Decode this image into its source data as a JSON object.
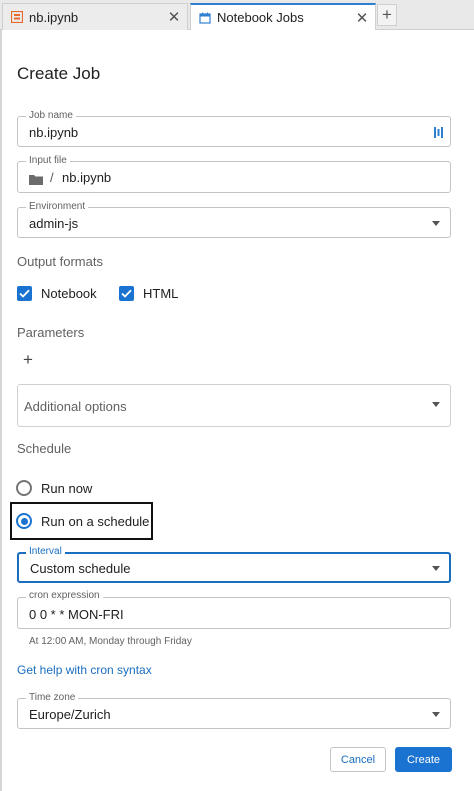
{
  "tabs": [
    {
      "label": "nb.ipynb",
      "icon": "notebook-icon",
      "active": false
    },
    {
      "label": "Notebook Jobs",
      "icon": "calendar-icon",
      "active": true
    }
  ],
  "tab_close_glyph": "✕",
  "tab_add_glyph": "+",
  "page_title": "Create Job",
  "job_name": {
    "label": "Job name",
    "value": "nb.ipynb"
  },
  "input_file": {
    "label": "Input file",
    "separator": "/",
    "value": "nb.ipynb"
  },
  "environment": {
    "label": "Environment",
    "value": "admin-js"
  },
  "output_formats": {
    "label": "Output formats",
    "options": [
      {
        "label": "Notebook",
        "checked": true
      },
      {
        "label": "HTML",
        "checked": true
      }
    ]
  },
  "parameters": {
    "label": "Parameters",
    "add_glyph": "+"
  },
  "additional_options": {
    "label": "Additional options"
  },
  "schedule": {
    "label": "Schedule",
    "options": [
      {
        "label": "Run now",
        "selected": false
      },
      {
        "label": "Run on a schedule",
        "selected": true
      }
    ]
  },
  "interval": {
    "label": "Interval",
    "value": "Custom schedule"
  },
  "cron": {
    "label": "cron expression",
    "value": "0 0 * * MON-FRI",
    "helper": "At 12:00 AM, Monday through Friday"
  },
  "cron_help_link": "Get help with cron syntax",
  "time_zone": {
    "label": "Time zone",
    "value": "Europe/Zurich"
  },
  "buttons": {
    "cancel": "Cancel",
    "create": "Create"
  },
  "colors": {
    "accent": "#1a73d0",
    "tab_bar": "#e9e9e9",
    "notebook_icon": "#e8692c"
  }
}
